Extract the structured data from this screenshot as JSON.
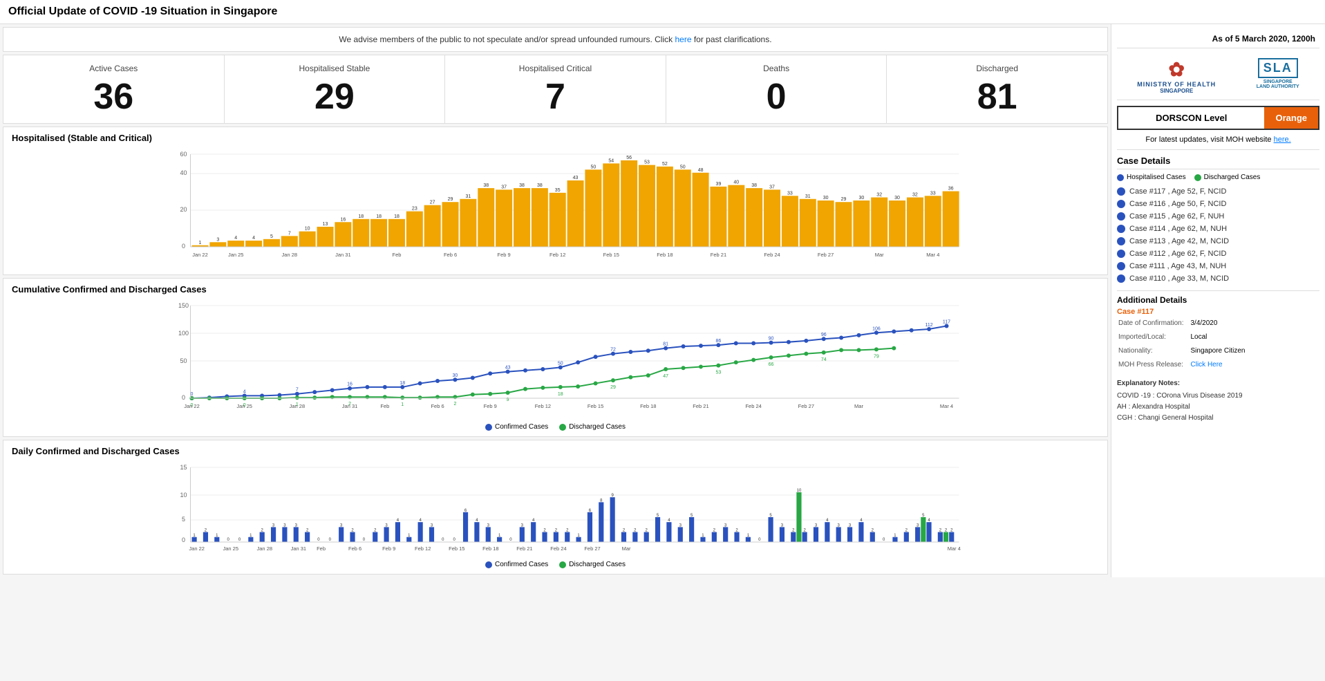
{
  "page": {
    "title": "Official Update of COVID -19 Situation in Singapore"
  },
  "advisory": {
    "text": "We advise members of the public to not speculate and/or spread unfounded rumours. Click ",
    "link_text": "here",
    "text2": " for past clarifications."
  },
  "stats": {
    "active_cases_label": "Active Cases",
    "active_cases_value": "36",
    "hospitalised_stable_label": "Hospitalised Stable",
    "hospitalised_stable_value": "29",
    "hospitalised_critical_label": "Hospitalised Critical",
    "hospitalised_critical_value": "7",
    "deaths_label": "Deaths",
    "deaths_value": "0",
    "discharged_label": "Discharged",
    "discharged_value": "81"
  },
  "right_panel": {
    "date_header": "As of 5 March 2020, 1200h",
    "dorscon_label": "DORSCON Level",
    "dorscon_value": "Orange",
    "moh_update": "For latest updates, visit MOH website ",
    "moh_link": "here.",
    "case_details_title": "Case Details",
    "legend_hospitalised": "Hospitalised Cases",
    "legend_discharged": "Discharged Cases",
    "cases": [
      "Case #117 , Age 52, F, NCID",
      "Case #116 , Age 50, F, NCID",
      "Case #115 , Age 62, F, NUH",
      "Case #114 , Age 62, M, NUH",
      "Case #113 , Age 42, M, NCID",
      "Case #112 , Age 62, F, NCID",
      "Case #111 , Age 43, M, NUH",
      "Case #110 , Age 33, M, NCID"
    ],
    "additional_details_title": "Additional Details",
    "case_highlight": "Case #117",
    "date_of_confirmation_label": "Date of Confirmation:",
    "date_of_confirmation_value": "3/4/2020",
    "imported_local_label": "Imported/Local:",
    "imported_local_value": "Local",
    "nationality_label": "Nationality:",
    "nationality_value": "Singapore Citizen",
    "moh_press_label": "MOH Press Release:",
    "moh_press_link": "Click Here",
    "explanatory_title": "Explanatory Notes:",
    "explanatory": [
      "COVID -19 : COrona Virus Disease 2019",
      "AH : Alexandra Hospital",
      "CGH : Changi General Hospital"
    ]
  },
  "bar_chart": {
    "title": "Hospitalised (Stable and Critical)",
    "max": 60,
    "bars": [
      {
        "label": "Jan 22",
        "value": 1
      },
      {
        "label": "",
        "value": 3
      },
      {
        "label": "Jan 25",
        "value": 4
      },
      {
        "label": "",
        "value": 4
      },
      {
        "label": "",
        "value": 5
      },
      {
        "label": "Jan 28",
        "value": 7
      },
      {
        "label": "",
        "value": 10
      },
      {
        "label": "",
        "value": 13
      },
      {
        "label": "Jan 31",
        "value": 16
      },
      {
        "label": "",
        "value": 18
      },
      {
        "label": "",
        "value": 18
      },
      {
        "label": "Feb",
        "value": 18
      },
      {
        "label": "",
        "value": 23
      },
      {
        "label": "",
        "value": 27
      },
      {
        "label": "Feb 6",
        "value": 29
      },
      {
        "label": "",
        "value": 31
      },
      {
        "label": "",
        "value": 38
      },
      {
        "label": "Feb 9",
        "value": 37
      },
      {
        "label": "",
        "value": 38
      },
      {
        "label": "",
        "value": 38
      },
      {
        "label": "Feb 12",
        "value": 35
      },
      {
        "label": "",
        "value": 43
      },
      {
        "label": "",
        "value": 50
      },
      {
        "label": "Feb 15",
        "value": 54
      },
      {
        "label": "",
        "value": 56
      },
      {
        "label": "",
        "value": 53
      },
      {
        "label": "Feb 18",
        "value": 52
      },
      {
        "label": "",
        "value": 50
      },
      {
        "label": "",
        "value": 48
      },
      {
        "label": "Feb 21",
        "value": 39
      },
      {
        "label": "",
        "value": 40
      },
      {
        "label": "",
        "value": 38
      },
      {
        "label": "Feb 24",
        "value": 37
      },
      {
        "label": "",
        "value": 33
      },
      {
        "label": "",
        "value": 31
      },
      {
        "label": "Feb 27",
        "value": 30
      },
      {
        "label": "",
        "value": 29
      },
      {
        "label": "",
        "value": 30
      },
      {
        "label": "Mar",
        "value": 32
      },
      {
        "label": "",
        "value": 30
      },
      {
        "label": "",
        "value": 32
      },
      {
        "label": "Mar 4",
        "value": 33
      },
      {
        "label": "",
        "value": 36
      }
    ]
  },
  "cumulative_chart": {
    "title": "Cumulative Confirmed and Discharged Cases",
    "confirmed_data": [
      0,
      1,
      3,
      4,
      4,
      5,
      7,
      10,
      13,
      16,
      18,
      18,
      18,
      24,
      28,
      30,
      33,
      40,
      43,
      45,
      47,
      50,
      58,
      67,
      72,
      75,
      77,
      81,
      84,
      85,
      86,
      89,
      89,
      90,
      91,
      93,
      96,
      98,
      102,
      106,
      108,
      110,
      112,
      117
    ],
    "discharged_data": [
      0,
      0,
      0,
      0,
      0,
      0,
      1,
      1,
      2,
      2,
      2,
      2,
      1,
      1,
      2,
      2,
      6,
      7,
      9,
      15,
      17,
      18,
      19,
      24,
      29,
      34,
      37,
      47,
      49,
      51,
      53,
      58,
      62,
      66,
      69,
      72,
      74,
      78,
      78,
      79,
      81,
      null,
      null,
      null
    ],
    "labels": [
      "Jan 22",
      "Jan 25",
      "Jan 28",
      "Jan 31",
      "Feb",
      "Feb 6",
      "Feb 9",
      "Feb 12",
      "Feb 15",
      "Feb 18",
      "Feb 21",
      "Feb 24",
      "Feb 27",
      "Mar",
      "Mar 4"
    ]
  },
  "daily_chart": {
    "title": "Daily Confirmed and Discharged Cases",
    "legend_confirmed": "Confirmed Cases",
    "legend_discharged": "Discharged Cases",
    "confirmed": [
      1,
      2,
      1,
      0,
      0,
      1,
      2,
      3,
      3,
      3,
      2,
      0,
      0,
      3,
      2,
      0,
      2,
      3,
      4,
      1,
      4,
      3,
      0,
      0,
      6,
      4,
      3,
      1,
      0,
      3,
      4,
      2,
      2,
      2,
      1,
      6,
      8,
      9,
      2,
      2,
      2,
      5,
      4,
      3,
      5,
      1,
      2,
      3,
      2,
      1,
      0,
      5,
      3,
      2,
      2,
      3,
      4,
      3,
      3,
      4,
      2,
      0,
      1,
      2,
      3,
      4,
      2,
      2
    ],
    "discharged": [
      0,
      0,
      0,
      0,
      0,
      0,
      0,
      0,
      0,
      0,
      0,
      0,
      0,
      0,
      0,
      0,
      0,
      0,
      0,
      0,
      0,
      0,
      0,
      0,
      0,
      0,
      0,
      0,
      0,
      0,
      0,
      0,
      0,
      0,
      0,
      0,
      0,
      0,
      0,
      0,
      0,
      0,
      0,
      0,
      0,
      0,
      0,
      0,
      0,
      0,
      0,
      0,
      0,
      10,
      0,
      0,
      0,
      0,
      0,
      0,
      0,
      0,
      0,
      0,
      5,
      0,
      2,
      0
    ]
  }
}
